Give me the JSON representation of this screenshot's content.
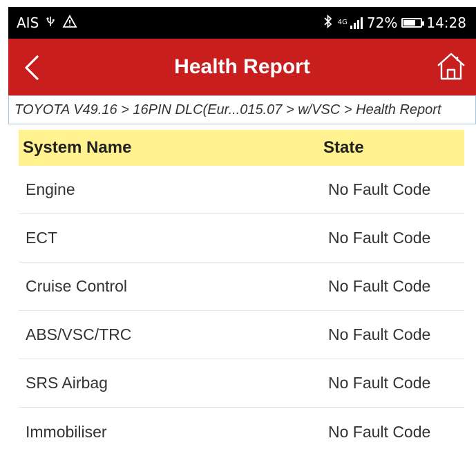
{
  "status_bar": {
    "carrier": "AIS",
    "usb_icon": "usb-icon",
    "warning_icon": "warning-icon",
    "bluetooth_icon": "bluetooth-icon",
    "network": "4G",
    "battery_percent": "72%",
    "battery_level": 0.72,
    "time": "14:28"
  },
  "header": {
    "title": "Health Report",
    "back_icon": "chevron-left-icon",
    "home_icon": "home-icon",
    "background": "#c81e1e"
  },
  "breadcrumb": "TOYOTA V49.16 > 16PIN DLC(Eur...015.07 > w/VSC > Health Report",
  "table": {
    "header_color": "#fff28f",
    "columns": {
      "name": "System Name",
      "state": "State"
    },
    "rows": [
      {
        "name": "Engine",
        "state": "No Fault Code"
      },
      {
        "name": "ECT",
        "state": "No Fault Code"
      },
      {
        "name": "Cruise Control",
        "state": "No Fault Code"
      },
      {
        "name": "ABS/VSC/TRC",
        "state": "No Fault Code"
      },
      {
        "name": "SRS Airbag",
        "state": "No Fault Code"
      },
      {
        "name": "Immobiliser",
        "state": "No Fault Code"
      }
    ]
  }
}
